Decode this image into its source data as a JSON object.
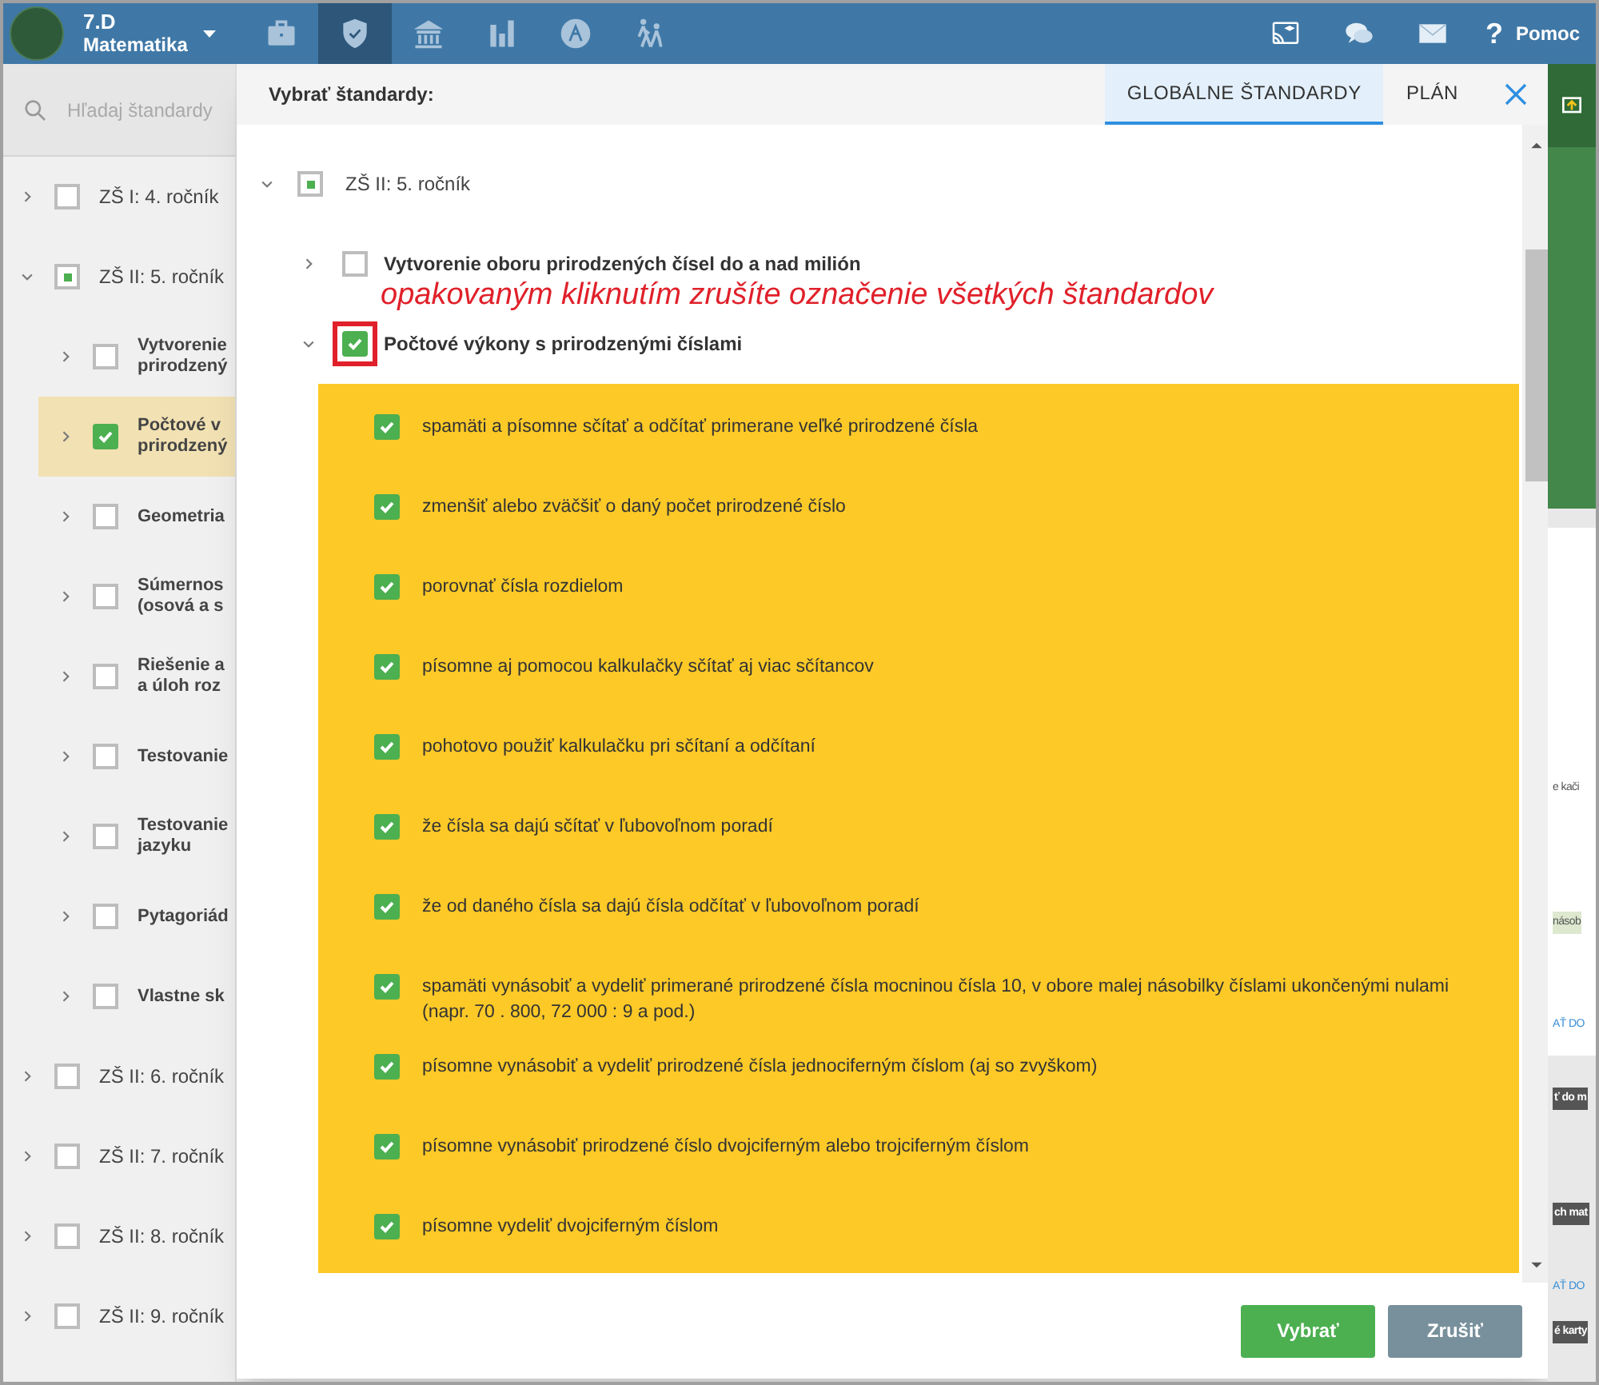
{
  "header": {
    "class_name": "7.D",
    "subject": "Matematika",
    "nav": [
      {
        "kind": "briefcase",
        "selected": false
      },
      {
        "kind": "shield",
        "selected": true
      },
      {
        "kind": "bank",
        "selected": false
      },
      {
        "kind": "chart",
        "selected": false
      },
      {
        "kind": "compass",
        "selected": false
      },
      {
        "kind": "walkers",
        "selected": false
      }
    ],
    "actions": [
      {
        "kind": "cast"
      },
      {
        "kind": "chat"
      },
      {
        "kind": "mail"
      }
    ],
    "help": {
      "icon": "?",
      "label": "Pomoc"
    }
  },
  "sidebar": {
    "search": {
      "placeholder": "Hľadaj štandardy"
    },
    "tree": [
      {
        "lines": [
          "ZŠ I: 4. ročník"
        ],
        "checked": false,
        "partial": false,
        "expanded": false,
        "selected": false
      },
      {
        "lines": [
          "ZŠ II: 5. ročník"
        ],
        "checked": false,
        "partial": true,
        "expanded": true,
        "selected": false,
        "children": [
          {
            "lines": [
              "Vytvorenie",
              "prirodzený"
            ],
            "checked": false,
            "partial": false,
            "expanded": false,
            "selected": false
          },
          {
            "lines": [
              "Počtové v",
              "prirodzený"
            ],
            "checked": true,
            "partial": false,
            "expanded": false,
            "selected": true
          },
          {
            "lines": [
              "Geometria"
            ],
            "checked": false,
            "partial": false,
            "expanded": false,
            "selected": false
          },
          {
            "lines": [
              "Súmernos",
              "(osová a s"
            ],
            "checked": false,
            "partial": false,
            "expanded": false,
            "selected": false
          },
          {
            "lines": [
              "Riešenie a",
              "a úloh roz"
            ],
            "checked": false,
            "partial": false,
            "expanded": false,
            "selected": false
          },
          {
            "lines": [
              "Testovanie"
            ],
            "checked": false,
            "partial": false,
            "expanded": false,
            "selected": false
          },
          {
            "lines": [
              "Testovanie",
              "jazyku"
            ],
            "checked": false,
            "partial": false,
            "expanded": false,
            "selected": false
          },
          {
            "lines": [
              "Pytagoriád"
            ],
            "checked": false,
            "partial": false,
            "expanded": false,
            "selected": false
          },
          {
            "lines": [
              "Vlastne sk"
            ],
            "checked": false,
            "partial": false,
            "expanded": false,
            "selected": false
          }
        ]
      },
      {
        "lines": [
          "ZŠ II: 6. ročník"
        ],
        "checked": false,
        "partial": false,
        "expanded": false,
        "selected": false
      },
      {
        "lines": [
          "ZŠ II: 7. ročník"
        ],
        "checked": false,
        "partial": false,
        "expanded": false,
        "selected": false
      },
      {
        "lines": [
          "ZŠ II: 8. ročník"
        ],
        "checked": false,
        "partial": false,
        "expanded": false,
        "selected": false
      },
      {
        "lines": [
          "ZŠ II: 9. ročník"
        ],
        "checked": false,
        "partial": false,
        "expanded": false,
        "selected": false
      }
    ]
  },
  "background_fragments": [
    {
      "kind": "text",
      "text": "e kači"
    },
    {
      "kind": "highlight",
      "text": "násob"
    },
    {
      "kind": "link",
      "text": "AŤ DO"
    },
    {
      "kind": "dark",
      "text": "ť do m"
    },
    {
      "kind": "dark",
      "text": "ch mat"
    },
    {
      "kind": "link",
      "text": "AŤ DO"
    },
    {
      "kind": "dark",
      "text": "é karty"
    }
  ],
  "dialog": {
    "title": "Vybrať štandardy:",
    "tabs": [
      {
        "label": "GLOBÁLNE ŠTANDARDY",
        "selected": true
      },
      {
        "label": "PLÁN",
        "selected": false
      }
    ],
    "root": {
      "label": "ZŠ II: 5. ročník",
      "checked": false,
      "partial": true,
      "expanded": true
    },
    "groups": [
      {
        "label": "Vytvorenie oboru prirodzených čísel do a nad milión",
        "checked": false,
        "partial": false,
        "expanded": false,
        "highlighted": false
      },
      {
        "label": "Počtové výkony s prirodzenými číslami",
        "checked": true,
        "partial": false,
        "expanded": true,
        "highlighted": true,
        "items": [
          {
            "label": "spamäti a písomne sčítať a odčítať primerane veľké prirodzené čísla",
            "checked": true
          },
          {
            "label": "zmenšiť alebo zväčšiť o daný počet prirodzené číslo",
            "checked": true
          },
          {
            "label": "porovnať čísla rozdielom",
            "checked": true
          },
          {
            "label": "písomne aj pomocou kalkulačky sčítať aj viac sčítancov",
            "checked": true
          },
          {
            "label": "pohotovo použiť kalkulačku pri sčítaní a odčítaní",
            "checked": true
          },
          {
            "label": "že čísla sa dajú sčítať v ľubovoľnom poradí",
            "checked": true
          },
          {
            "label": "že od daného čísla sa dajú čísla odčítať v ľubovoľnom poradí",
            "checked": true
          },
          {
            "label": "spamäti vynásobiť a vydeliť primerané prirodzené čísla mocninou čísla 10, v obore malej násobilky číslami ukončenými nulami (napr. 70 . 800, 72 000 : 9 a pod.)",
            "checked": true
          },
          {
            "label": "písomne vynásobiť a vydeliť prirodzené čísla jednociferným číslom (aj so zvyškom)",
            "checked": true
          },
          {
            "label": "písomne vynásobiť prirodzené číslo dvojciferným alebo trojciferným číslom",
            "checked": true
          },
          {
            "label": "písomne vydeliť dvojciferným číslom",
            "checked": true
          }
        ]
      }
    ],
    "annotation": "opakovaným kliknutím zrušíte označenie všetkých štandardov",
    "buttons": [
      {
        "kind": "primary",
        "label": "Vybrať"
      },
      {
        "kind": "secondary",
        "label": "Zrušiť"
      }
    ]
  }
}
